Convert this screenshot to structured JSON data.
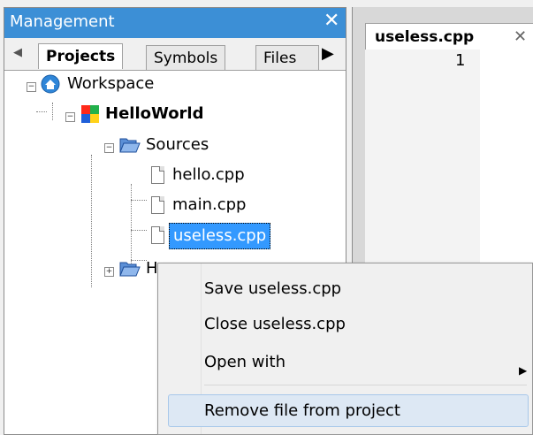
{
  "management": {
    "title": "Management",
    "close": "✕",
    "tabs": [
      {
        "label": "Projects",
        "active": true
      },
      {
        "label": "Symbols",
        "active": false
      },
      {
        "label": "Files",
        "active": false
      }
    ]
  },
  "tree": {
    "workspace": "Workspace",
    "project": "HelloWorld",
    "folder_sources": "Sources",
    "files": [
      "hello.cpp",
      "main.cpp",
      "useless.cpp"
    ],
    "selected_file": "useless.cpp",
    "folder_partial": "H"
  },
  "editor": {
    "tab_label": "useless.cpp",
    "tab_close": "✕",
    "line_number": "1"
  },
  "context_menu": {
    "items": [
      {
        "label": "Save useless.cpp"
      },
      {
        "label": "Close useless.cpp"
      },
      {
        "label": "Open with",
        "submenu": true
      },
      {
        "label": "Remove file from project",
        "highlighted": true
      }
    ]
  },
  "colors": {
    "header": "#3c8fd6",
    "selection": "#3399ff",
    "menu_hover": "#dde8f4"
  }
}
